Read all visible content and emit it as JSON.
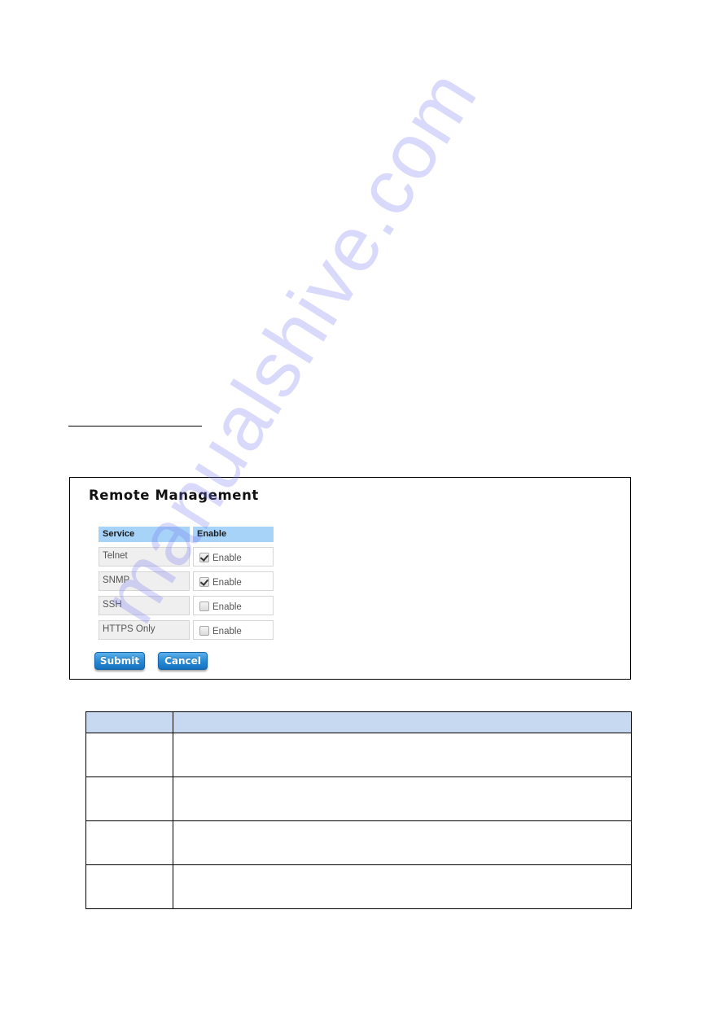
{
  "panel": {
    "title": "Remote Management",
    "table": {
      "headers": [
        "Service",
        "Enable"
      ],
      "rows": [
        {
          "service": "Telnet",
          "enable_label": "Enable",
          "checked": true
        },
        {
          "service": "SNMP",
          "enable_label": "Enable",
          "checked": true
        },
        {
          "service": "SSH",
          "enable_label": "Enable",
          "checked": false
        },
        {
          "service": "HTTPS Only",
          "enable_label": "Enable",
          "checked": false
        }
      ]
    },
    "buttons": {
      "submit": "Submit",
      "cancel": "Cancel"
    }
  },
  "description_table": {
    "headers": [
      "",
      ""
    ],
    "rows": [
      [
        "",
        ""
      ],
      [
        "",
        ""
      ],
      [
        "",
        ""
      ],
      [
        "",
        ""
      ]
    ]
  },
  "colors": {
    "table_header": "#a7d3f8",
    "desc_header": "#c6d9f1",
    "button": "#2a8bd6"
  },
  "watermark": "manualshive.com"
}
